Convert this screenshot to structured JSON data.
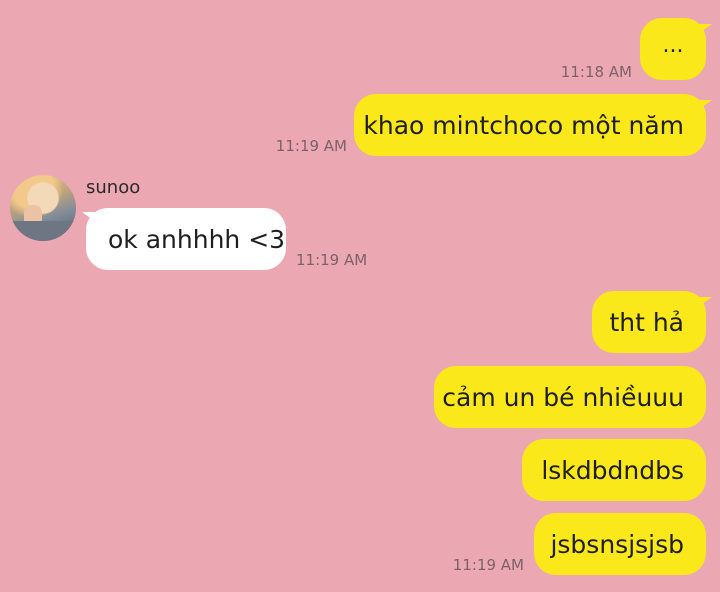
{
  "contact": {
    "name": "sunoo",
    "avatar_icon": "profile-photo"
  },
  "colors": {
    "background": "#eca8b2",
    "my_bubble": "#fbe81a",
    "their_bubble": "#ffffff",
    "timestamp": "#7c6268"
  },
  "messages": [
    {
      "from": "me",
      "text": "...",
      "time": "11:18 AM"
    },
    {
      "from": "me",
      "text": "khao mintchoco một năm",
      "time": "11:19 AM"
    },
    {
      "from": "sunoo",
      "text": "ok anhhhh <3",
      "time": "11:19 AM"
    },
    {
      "from": "me",
      "text": "tht hả",
      "time": ""
    },
    {
      "from": "me",
      "text": "cảm un bé nhiềuuu",
      "time": ""
    },
    {
      "from": "me",
      "text": "lskdbdndbs",
      "time": ""
    },
    {
      "from": "me",
      "text": "jsbsnsjsjsb",
      "time": "11:19 AM"
    }
  ]
}
